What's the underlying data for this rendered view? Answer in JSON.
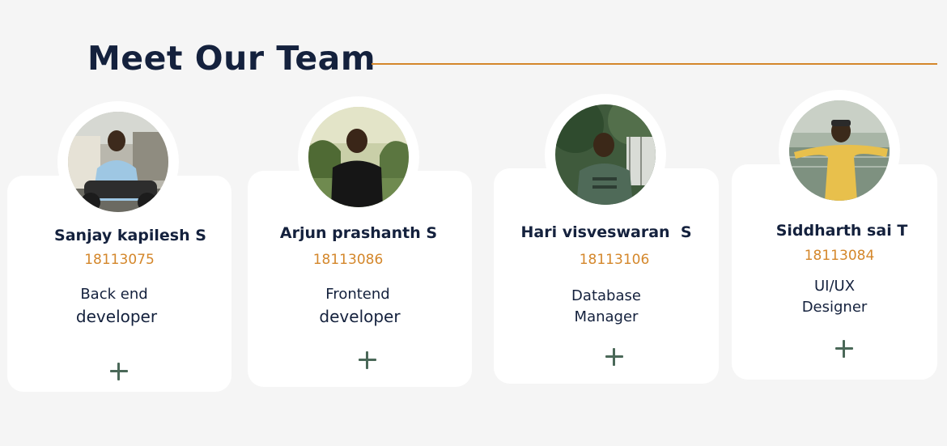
{
  "section": {
    "title": "Meet Our Team",
    "accent_color": "#d4872b",
    "title_color": "#14213d"
  },
  "members": [
    {
      "name": "Sanjay kapilesh S",
      "roll": "18113075",
      "role_line1": "Back end",
      "role_line2": "developer",
      "photo_icon": "portrait-photo"
    },
    {
      "name": "Arjun prashanth S",
      "roll": "18113086",
      "role_line1": "Frontend",
      "role_line2": "developer",
      "photo_icon": "portrait-photo"
    },
    {
      "name": "Hari visveswaran  S",
      "roll": "18113106",
      "role_line1": "Database",
      "role_line2": "Manager",
      "photo_icon": "portrait-photo"
    },
    {
      "name": "Siddharth sai T",
      "roll": "18113084",
      "role_line1": "UI/UX",
      "role_line2": "Designer",
      "photo_icon": "portrait-photo"
    }
  ]
}
